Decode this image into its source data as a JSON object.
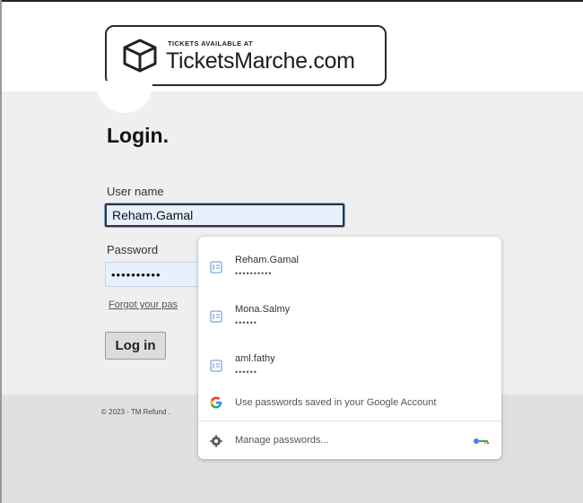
{
  "header": {
    "logo_small_text": "TICKETS AVAILABLE AT",
    "logo_brand": "TicketsMarche.com"
  },
  "form": {
    "title": "Login.",
    "username_label": "User name",
    "username_value": "Reham.Gamal",
    "password_label": "Password",
    "password_value": "••••••••••",
    "forgot_link": "Forgot your pas",
    "login_button": "Log in"
  },
  "footer": {
    "copyright": "© 2023 - TM Refund ."
  },
  "autofill": {
    "credentials": [
      {
        "username": "Reham.Gamal",
        "masked": "••••••••••"
      },
      {
        "username": "Mona.Salmy",
        "masked": "••••••"
      },
      {
        "username": "aml.fathy",
        "masked": "••••••"
      }
    ],
    "google_option": "Use passwords saved in your Google Account",
    "manage_option": "Manage passwords..."
  },
  "icons": {
    "logo": "ticket-box-icon",
    "credential": "key-card-icon",
    "google": "google-g-icon",
    "manage": "gear-icon",
    "password_key": "password-key-icon"
  }
}
